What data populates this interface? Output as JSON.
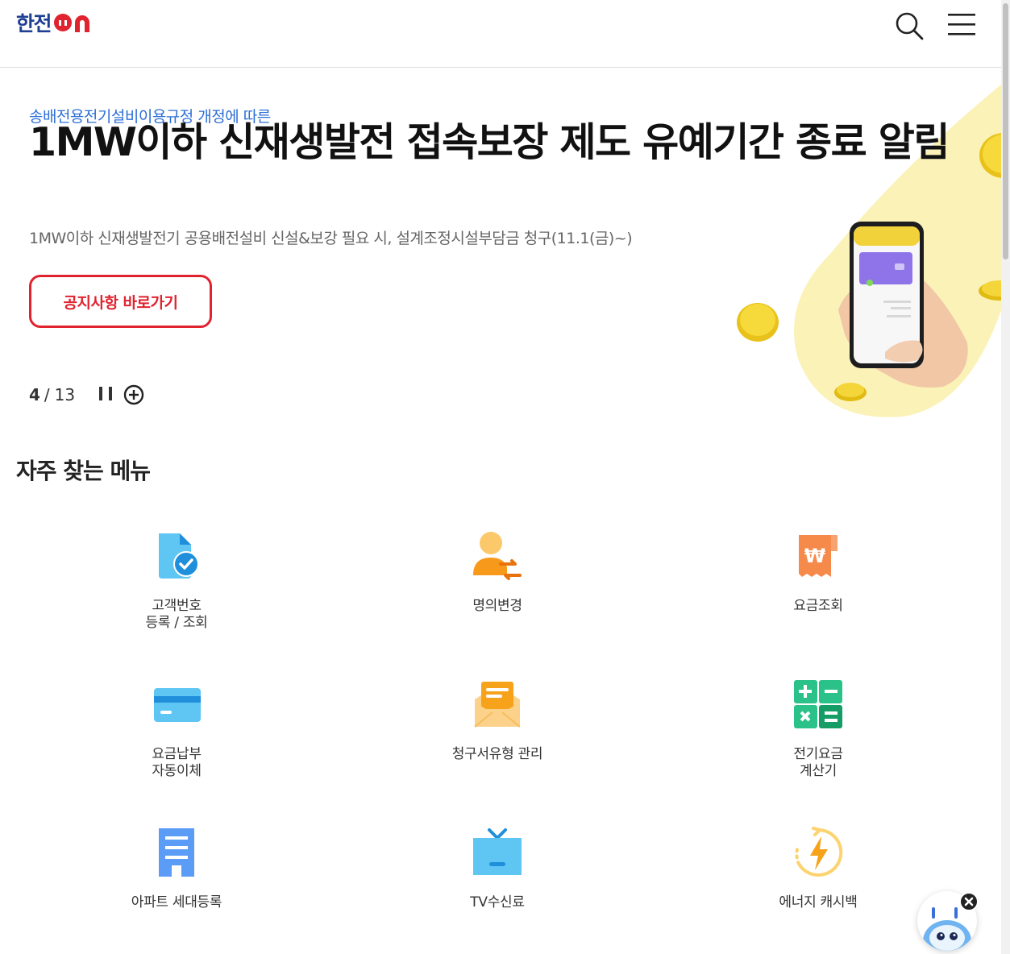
{
  "header": {
    "logo_text": "한전",
    "logo_on": "ON"
  },
  "banner": {
    "subtitle": "송배전용전기설비이용규정 개정에 따른",
    "title": "1MW이하 신재생발전 접속보장 제도 유예기간 종료 알림",
    "description": "1MW이하 신재생발전기 공용배전설비 신설&보강 필요 시, 설계조정시설부담금 청구(11.1(금)~)",
    "button_label": "공지사항 바로가기",
    "pager": {
      "current": "4",
      "separator": "/",
      "total": "13"
    }
  },
  "section": {
    "title": "자주 찾는 메뉴"
  },
  "menu": [
    {
      "label": "고객번호\n등록 / 조회",
      "icon": "document-check-icon"
    },
    {
      "label": "명의변경",
      "icon": "person-transfer-icon"
    },
    {
      "label": "요금조회",
      "icon": "won-receipt-icon"
    },
    {
      "label": "요금납부\n자동이체",
      "icon": "credit-card-icon"
    },
    {
      "label": "청구서유형 관리",
      "icon": "envelope-icon"
    },
    {
      "label": "전기요금\n계산기",
      "icon": "calculator-icon"
    },
    {
      "label": "아파트 세대등록",
      "icon": "apartment-icon"
    },
    {
      "label": "TV수신료",
      "icon": "tv-icon"
    },
    {
      "label": "에너지 캐시백",
      "icon": "energy-cashback-icon"
    }
  ],
  "colors": {
    "brand_blue": "#1f3f92",
    "accent_red": "#e0232f",
    "link_blue": "#2d6fd6",
    "banner_yellow": "#fbf2b8"
  }
}
